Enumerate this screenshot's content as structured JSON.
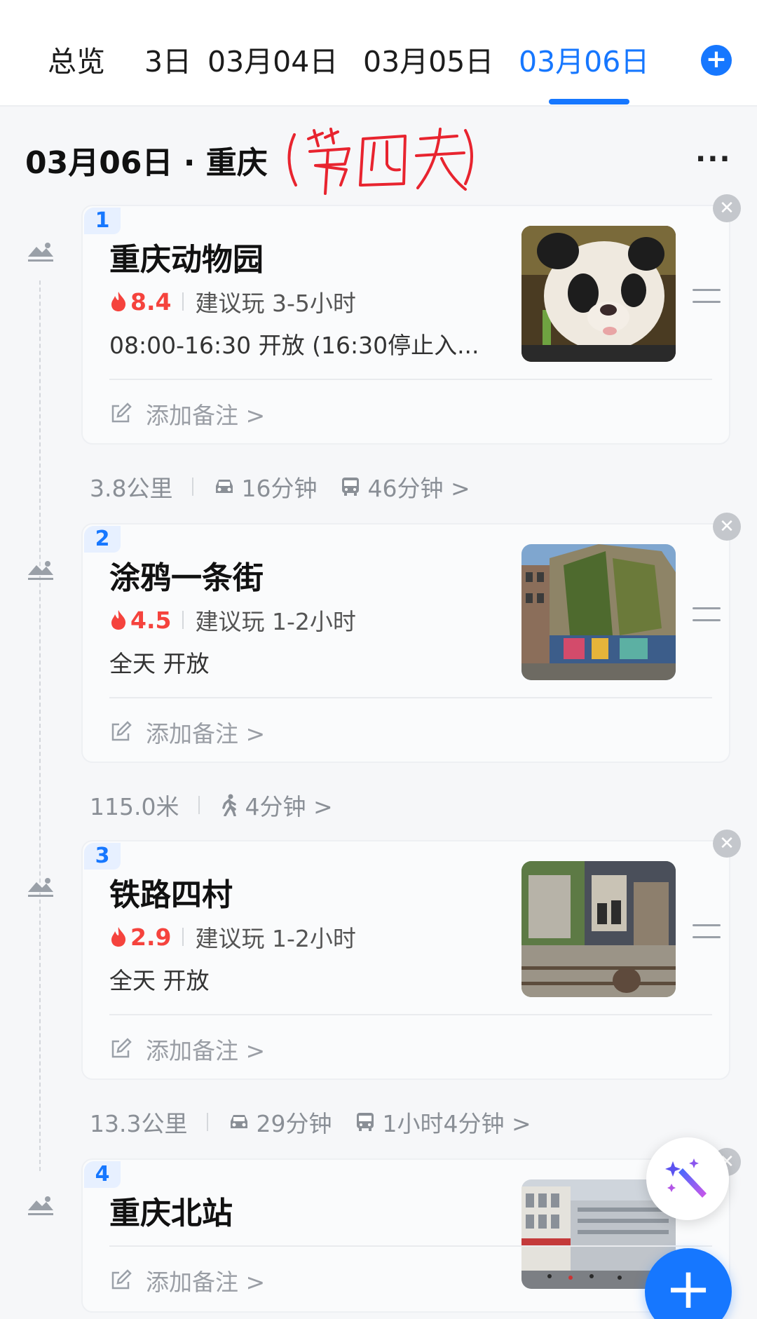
{
  "tabs": [
    {
      "label": "总览"
    },
    {
      "label": "3日"
    },
    {
      "label": "03月04日"
    },
    {
      "label": "03月05日"
    },
    {
      "label": "03月06日",
      "active": true
    }
  ],
  "day": {
    "title": "03月06日 · 重庆",
    "annotation": "(第四天)"
  },
  "spots": [
    {
      "index": "1",
      "name": "重庆动物园",
      "heat": "8.4",
      "suggest": "建议玩 3-5小时",
      "hours": "08:00-16:30 开放 (16:30停止入...",
      "note": "添加备注 >"
    },
    {
      "index": "2",
      "name": "涂鸦一条街",
      "heat": "4.5",
      "suggest": "建议玩 1-2小时",
      "hours": "全天 开放",
      "note": "添加备注 >"
    },
    {
      "index": "3",
      "name": "铁路四村",
      "heat": "2.9",
      "suggest": "建议玩 1-2小时",
      "hours": "全天 开放",
      "note": "添加备注 >"
    },
    {
      "index": "4",
      "name": "重庆北站",
      "note": "添加备注 >"
    }
  ],
  "routes": [
    {
      "distance": "3.8公里",
      "car": "16分钟",
      "bus": "46分钟 >"
    },
    {
      "distance": "115.0米",
      "walk": "4分钟 >"
    },
    {
      "distance": "13.3公里",
      "car": "29分钟",
      "bus": "1小时4分钟 >"
    }
  ],
  "colors": {
    "accent": "#1677ff",
    "heat": "#f5433d"
  }
}
